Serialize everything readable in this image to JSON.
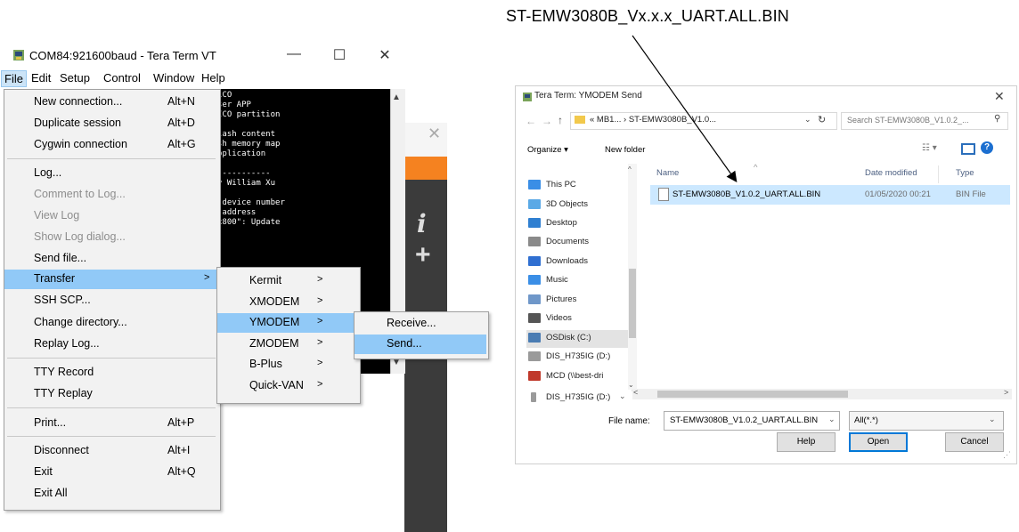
{
  "annotation": {
    "text": "ST-EMW3080B_Vx.x.x_UART.ALL.BIN"
  },
  "tera_term": {
    "title": "COM84:921600baud - Tera Term VT",
    "controls": {
      "minimize": "—",
      "maximize": "☐",
      "close": "✕"
    },
    "menubar": [
      "File",
      "Edit",
      "Setup",
      "Control",
      "Window",
      "Help"
    ],
    "terminal_text": "iCO\nser APP\nICO partition\n\nlash content\nsh memory map\npplication\n\n-----------\ny William Xu\n\n device number\n address\nx800\": Update",
    "file_menu": [
      {
        "label": "New connection...",
        "accel": "Alt+N"
      },
      {
        "label": "Duplicate session",
        "accel": "Alt+D"
      },
      {
        "label": "Cygwin connection",
        "accel": "Alt+G"
      },
      {
        "label": "Log..."
      },
      {
        "label": "Comment to Log...",
        "disabled": true
      },
      {
        "label": "View Log",
        "disabled": true
      },
      {
        "label": "Show Log dialog...",
        "disabled": true
      },
      {
        "label": "Send file..."
      },
      {
        "label": "Transfer",
        "submenu": true,
        "highlighted": true
      },
      {
        "label": "SSH SCP..."
      },
      {
        "label": "Change directory..."
      },
      {
        "label": "Replay Log..."
      },
      {
        "label": "TTY Record"
      },
      {
        "label": "TTY Replay"
      },
      {
        "label": "Print...",
        "accel": "Alt+P"
      },
      {
        "label": "Disconnect",
        "accel": "Alt+I"
      },
      {
        "label": "Exit",
        "accel": "Alt+Q"
      },
      {
        "label": "Exit All"
      }
    ],
    "transfer_menu": [
      {
        "label": "Kermit"
      },
      {
        "label": "XMODEM"
      },
      {
        "label": "YMODEM",
        "highlighted": true
      },
      {
        "label": "ZMODEM"
      },
      {
        "label": "B-Plus"
      },
      {
        "label": "Quick-VAN"
      }
    ],
    "ymodem_menu": [
      {
        "label": "Receive..."
      },
      {
        "label": "Send...",
        "highlighted": true
      }
    ],
    "submenu_arrow": ">",
    "background_glyphs": {
      "close": "✕",
      "info": "i",
      "plus": "+"
    }
  },
  "dialog": {
    "title": "Tera Term: YMODEM Send",
    "close": "✕",
    "address": "« MB1... › ST-EMW3080B_V1.0...",
    "search_placeholder": "Search ST-EMW3080B_V1.0.2_...",
    "organize": "Organize ▾",
    "new_folder": "New folder",
    "nav_items": [
      {
        "label": "This PC",
        "color": "#3a8ee6"
      },
      {
        "label": "3D Objects",
        "color": "#5aa9e6"
      },
      {
        "label": "Desktop",
        "color": "#2f7fd1"
      },
      {
        "label": "Documents",
        "color": "#8a8a8a"
      },
      {
        "label": "Downloads",
        "color": "#2f6fd1"
      },
      {
        "label": "Music",
        "color": "#3a8ee6"
      },
      {
        "label": "Pictures",
        "color": "#6f97c9"
      },
      {
        "label": "Videos",
        "color": "#555555"
      },
      {
        "label": "OSDisk (C:)",
        "color": "#4a7cb3",
        "selected": true
      },
      {
        "label": "DIS_H735IG (D:)",
        "color": "#9a9a9a"
      },
      {
        "label": "MCD (\\\\best-dri",
        "color": "#c0392b"
      }
    ],
    "nav_last": {
      "label": "DIS_H735IG (D:)",
      "color": "#9a9a9a"
    },
    "columns": {
      "name": "Name",
      "date": "Date modified",
      "type": "Type"
    },
    "file": {
      "name": "ST-EMW3080B_V1.0.2_UART.ALL.BIN",
      "date": "01/05/2020 00:21",
      "type": "BIN File"
    },
    "file_name_label": "File name:",
    "file_name_value": "ST-EMW3080B_V1.0.2_UART.ALL.BIN",
    "filter_value": "All(*.*)",
    "buttons": {
      "help": "Help",
      "open": "Open",
      "cancel": "Cancel"
    },
    "help_glyph": "?"
  }
}
